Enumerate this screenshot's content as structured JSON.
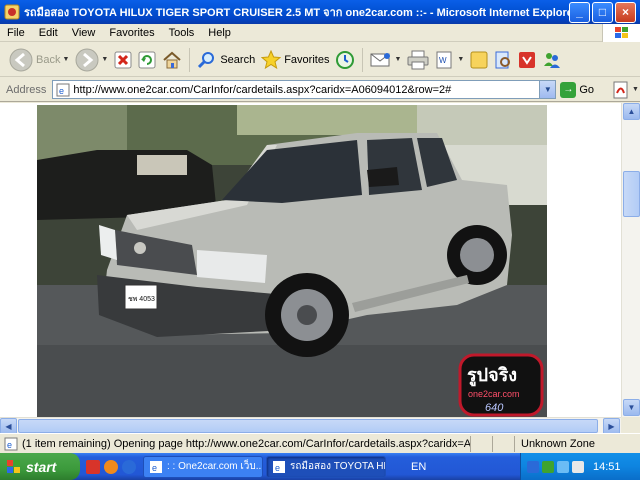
{
  "window": {
    "title": "รถมือสอง TOYOTA HILUX TIGER SPORT CRUISER 2.5 MT จาก one2car.com ::- - Microsoft Internet Explorer",
    "minimize": "_",
    "maximize": "□",
    "close": "×"
  },
  "menu": {
    "items": [
      "File",
      "Edit",
      "View",
      "Favorites",
      "Tools",
      "Help"
    ]
  },
  "toolbar": {
    "back_label": "Back",
    "search_label": "Search",
    "favorites_label": "Favorites"
  },
  "address": {
    "label": "Address",
    "url": "http://www.one2car.com/CarInfor/cardetails.aspx?caridx=A06094012&row=2#",
    "go_label": "Go"
  },
  "photo": {
    "watermark_main": "รูปจริง",
    "watermark_site": "one2car.com",
    "watermark_num": "640",
    "plate": "ชพ 4053"
  },
  "status": {
    "text": "(1 item remaining) Opening page http://www.one2car.com/CarInfor/cardetails.aspx?caridx=A0609401",
    "zone": "Unknown Zone"
  },
  "taskbar": {
    "start_label": "start",
    "tasks": [
      ": : One2car.com เว็บ...",
      "รถมือสอง TOYOTA HIL..."
    ],
    "lang": "EN",
    "clock": "14:51"
  },
  "colors": {
    "xp_blue": "#0a5fe8",
    "start_green": "#3c9a3c",
    "window_face": "#ece9d8"
  }
}
